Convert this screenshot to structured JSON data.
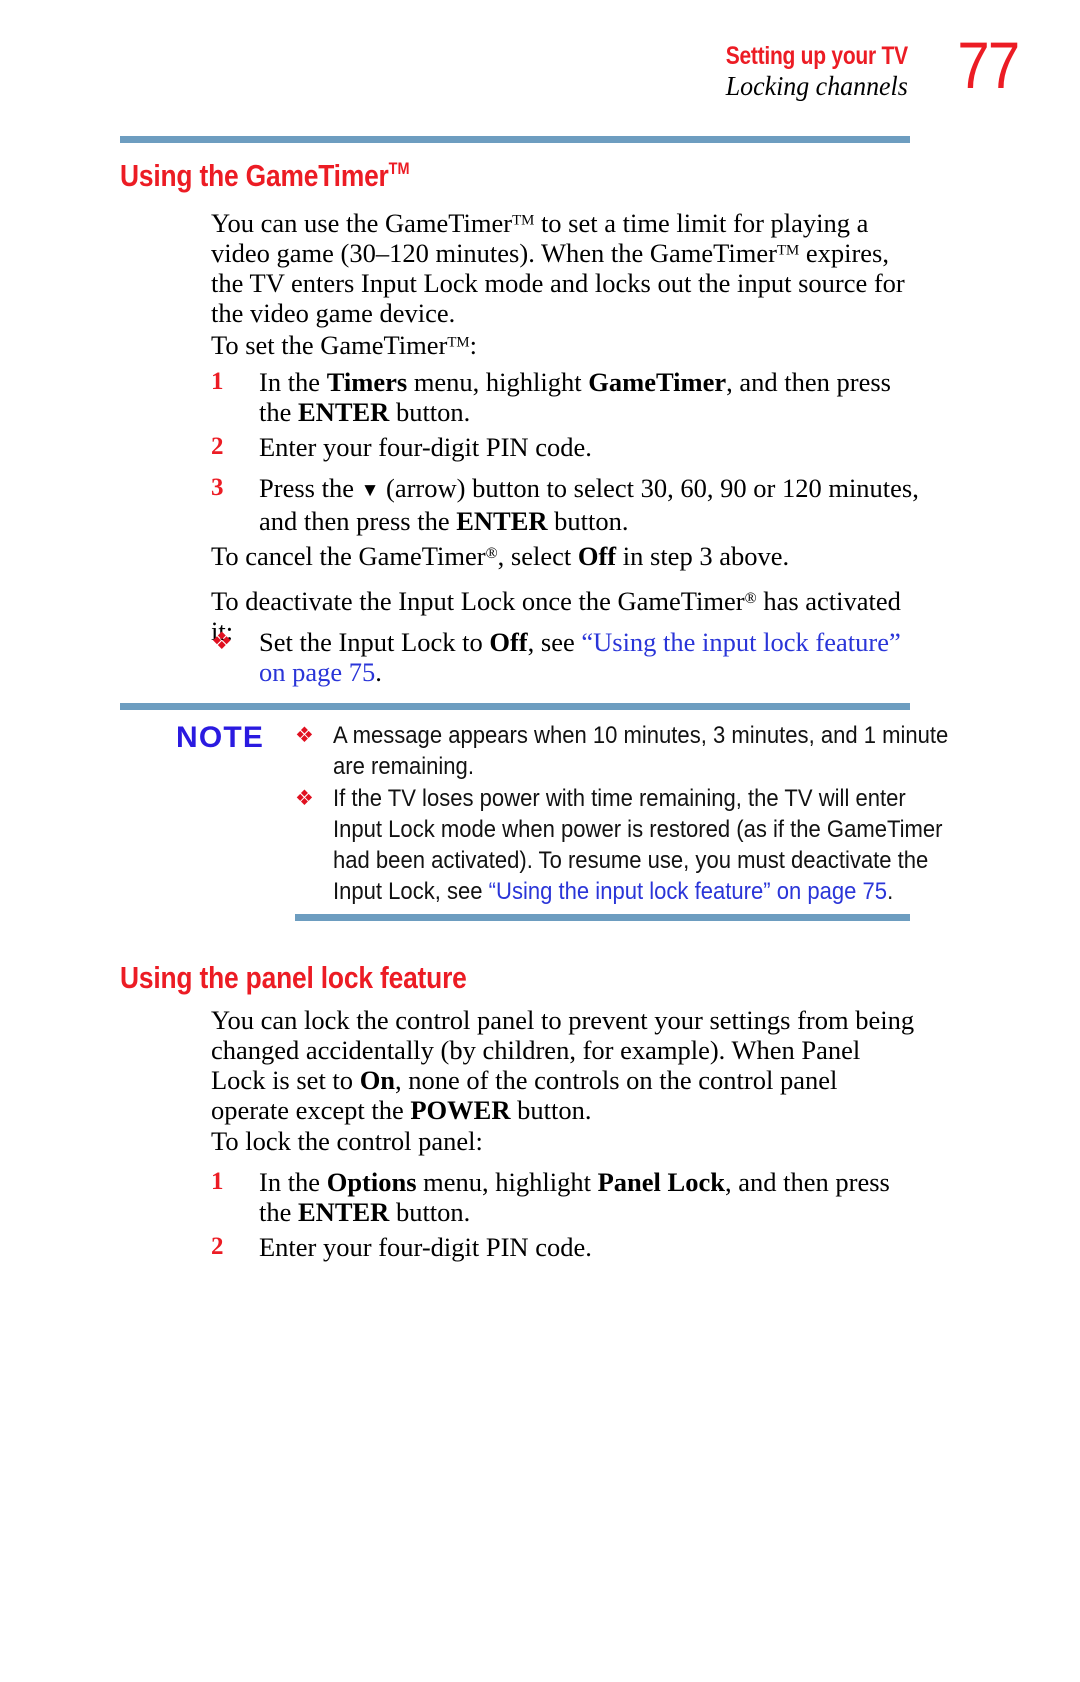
{
  "header": {
    "title": "Setting up your TV",
    "subtitle": "Locking channels",
    "page_number": "77",
    "rule_color": "#6d9dc0",
    "accent_color": "#ec1c24"
  },
  "sections": [
    {
      "heading": "Using the GameTimer",
      "heading_mark": "TM",
      "paragraphs": [
        "You can use the GameTimer<sup class=\"tm\">TM</sup> to set a time limit for playing a video game (30–120 minutes). When the GameTimer<sup class=\"tm\">TM</sup> expires, the TV enters Input Lock mode and locks out the input source for the video game device.",
        "To set the GameTimer<sup class=\"tm\">TM</sup>:"
      ],
      "steps": [
        {
          "number": "1",
          "text": "In the <b>Timers</b> menu, highlight <b>GameTimer</b>, and then press the <b>ENTER</b> button."
        },
        {
          "number": "2",
          "text": "Enter your four-digit PIN code."
        },
        {
          "number": "3",
          "text": "Press the <span class=\"tri\">▼</span> (arrow) button to select 30, 60, 90 or 120 minutes, and then press the <b>ENTER</b> button."
        }
      ],
      "after_steps": [
        "To cancel the GameTimer<sup class=\"reg\">®</sup>, select <b>Off</b> in step 3 above.",
        "To deactivate the Input Lock once the GameTimer<sup class=\"reg\">®</sup> has activated it:"
      ],
      "bullet": {
        "glyph": "❖",
        "text": "Set the Input Lock to <b>Off</b>, see <span class=\"link\">“Using the input lock feature” on page 75</span>."
      }
    },
    {
      "heading": "Using the panel lock feature",
      "paragraphs": [
        "You can lock the control panel to prevent your settings from being changed accidentally (by children, for example). When Panel Lock is set to <b>On</b>, none of the controls on the control panel operate except the <b>POWER</b> button.",
        "To lock the control panel:"
      ],
      "steps": [
        {
          "number": "1",
          "text": "In the <b>Options</b> menu,  highlight <b>Panel Lock</b>, and then press the <b>ENTER</b> button."
        },
        {
          "number": "2",
          "text": "Enter your four-digit PIN code."
        }
      ]
    }
  ],
  "note": {
    "label": "NOTE",
    "label_color": "#2a1ae0",
    "bullet_glyph": "❖",
    "items": [
      "A message appears when 10 minutes, 3 minutes, and 1 minute are remaining.",
      "If the TV loses power with time remaining, the TV will enter Input Lock mode when power is restored (as if the GameTimer had been activated). To resume use, you must deactivate the Input Lock, see <span class=\"link\">“Using the input lock feature” on page 75</span>."
    ]
  }
}
